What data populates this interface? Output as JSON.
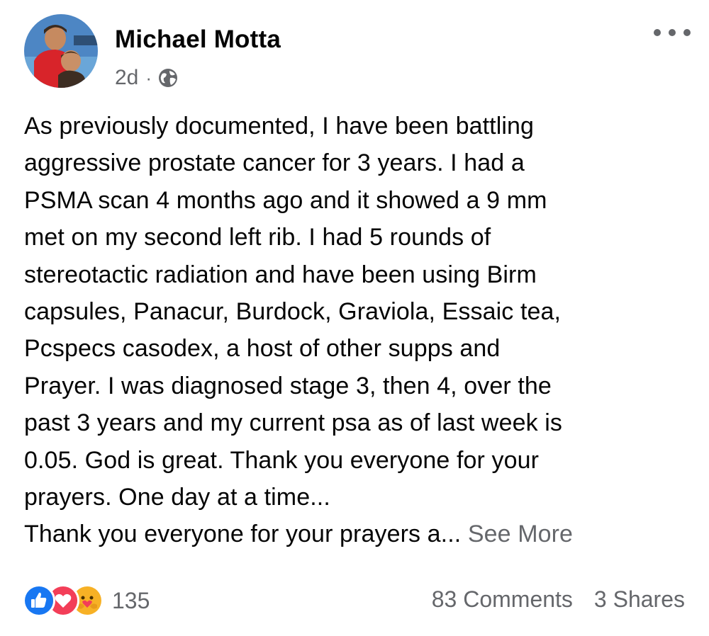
{
  "post": {
    "author": "Michael Motta",
    "timestamp": "2d",
    "separator": "·",
    "audience_icon": "globe-icon",
    "more_icon": "more-options-icon",
    "text_lines": [
      "As previously documented, I have been battling",
      "aggressive prostate cancer for 3 years. I had a",
      "PSMA scan 4 months ago and it showed a 9 mm",
      "met on my second left rib. I had 5 rounds of",
      "stereotactic radiation and have been using Birm",
      "capsules, Panacur, Burdock, Graviola, Essaic tea,",
      "Pcspecs casodex, a host of other supps and",
      "Prayer. I was diagnosed stage 3, then 4, over the",
      "past 3 years and my current psa as of last week is",
      "0.05. God is great. Thank you everyone for your",
      "prayers. One day at a time...",
      "Thank you everyone for your prayers a..."
    ],
    "see_more": "See More"
  },
  "engagement": {
    "reaction_icons": [
      "like-icon",
      "love-icon",
      "care-icon"
    ],
    "reaction_count": "135",
    "comments": "83 Comments",
    "shares": "3 Shares"
  },
  "colors": {
    "primary_text": "#050505",
    "secondary_text": "#65676b",
    "like_blue": "#1877f2",
    "love_red": "#f33e58",
    "care_yellow": "#f7b125"
  }
}
